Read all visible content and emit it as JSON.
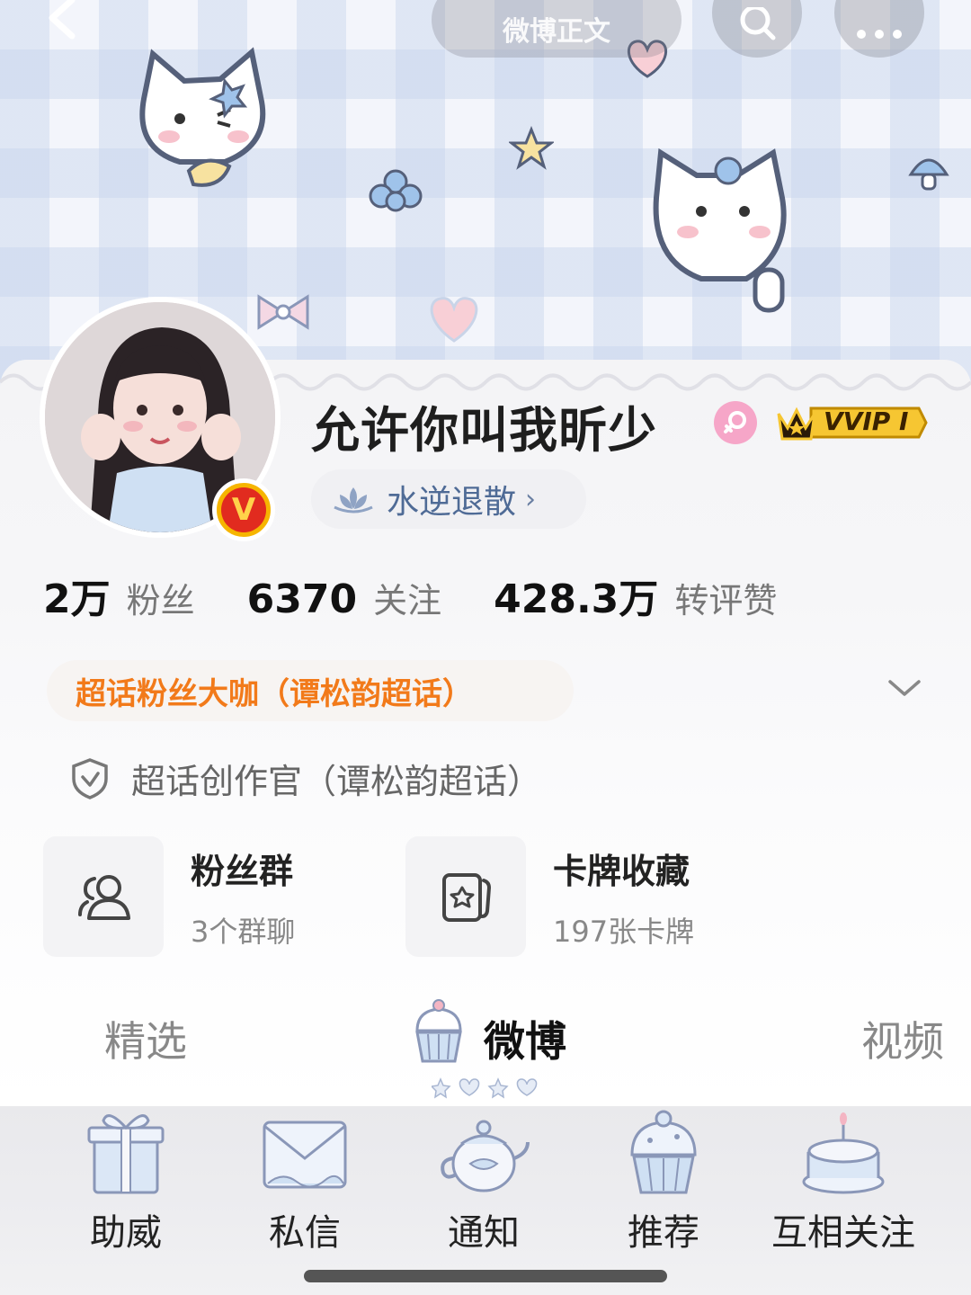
{
  "top_bar": {
    "title": "微博正文",
    "back_icon": "chevron-left-icon",
    "search_icon": "search-icon",
    "more_icon": "more-dots-icon"
  },
  "profile": {
    "username": "允许你叫我昕少",
    "gender_icon": "female-icon",
    "vip_badge": "VVIP I",
    "verified_icon": "verified-v-icon",
    "tag": "水逆退散",
    "tag_chevron": "›"
  },
  "stats": [
    {
      "value": "2万",
      "label": "粉丝"
    },
    {
      "value": "6370",
      "label": "关注"
    },
    {
      "value": "428.3万",
      "label": "转评赞"
    }
  ],
  "fan_title": "超话粉丝大咖（谭松韵超话）",
  "creator": "超话创作官（谭松韵超话）",
  "cards": [
    {
      "title": "粉丝群",
      "subtitle": "3个群聊",
      "icon": "group-icon"
    },
    {
      "title": "卡牌收藏",
      "subtitle": "197张卡牌",
      "icon": "card-icon"
    }
  ],
  "tabs": [
    {
      "label": "精选",
      "active": false
    },
    {
      "label": "微博",
      "active": true
    },
    {
      "label": "视频",
      "active": false
    }
  ],
  "bottom_nav": [
    {
      "label": "助威",
      "icon": "gift-box-icon"
    },
    {
      "label": "私信",
      "icon": "envelope-icon"
    },
    {
      "label": "通知",
      "icon": "teapot-icon"
    },
    {
      "label": "推荐",
      "icon": "cupcake-icon"
    },
    {
      "label": "互相关注",
      "icon": "cake-icon"
    }
  ],
  "colors": {
    "accent_orange": "#f27a1a",
    "tag_blue": "#4f6b96",
    "badge_gold": "#f6b500",
    "verified_red": "#e12b1f",
    "female_pink": "#f6a6c8"
  }
}
